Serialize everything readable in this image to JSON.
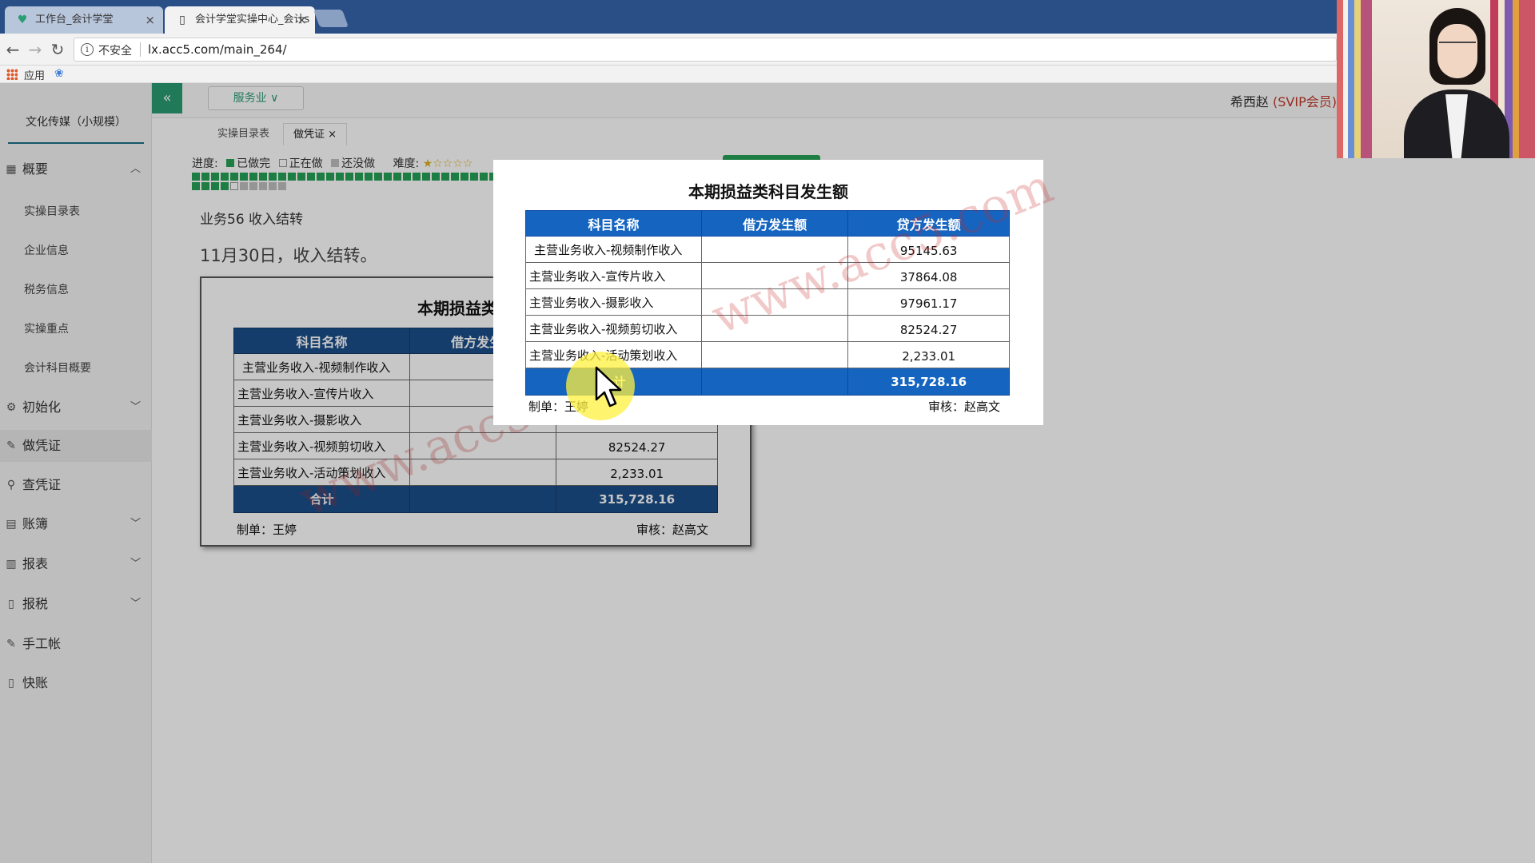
{
  "browser": {
    "tabs": [
      {
        "title": "工作台_会计学堂",
        "close": "×"
      },
      {
        "title": "会计学堂实操中心_会计s",
        "close": "×"
      }
    ],
    "security": "不安全",
    "url": "lx.acc5.com/main_264/",
    "bookmark_apps": "应用"
  },
  "header": {
    "collapse": "«",
    "industry": "服务业 ∨",
    "user": "希西赵",
    "vip": "(SVIP会员)"
  },
  "sidebar": {
    "company": "文化传媒（小规模）",
    "items": [
      {
        "label": "概要",
        "icon": "grid-icon",
        "arrow": "︿"
      },
      {
        "label": "初始化",
        "icon": "gear-icon",
        "arrow": "﹀"
      },
      {
        "label": "做凭证",
        "icon": "pen-icon",
        "arrow": ""
      },
      {
        "label": "查凭证",
        "icon": "search-icon",
        "arrow": ""
      },
      {
        "label": "账簿",
        "icon": "book-icon",
        "arrow": "﹀"
      },
      {
        "label": "报表",
        "icon": "report-icon",
        "arrow": "﹀"
      },
      {
        "label": "报税",
        "icon": "file-icon",
        "arrow": "﹀"
      },
      {
        "label": "手工帐",
        "icon": "pen-icon",
        "arrow": ""
      },
      {
        "label": "快账",
        "icon": "file-icon",
        "arrow": ""
      }
    ],
    "subitems": [
      "实操目录表",
      "企业信息",
      "税务信息",
      "实操重点",
      "会计科目概要"
    ]
  },
  "page_tabs": [
    {
      "label": "实操目录表"
    },
    {
      "label": "做凭证",
      "close": "×"
    }
  ],
  "progress": {
    "label": "进度:",
    "done": "已做完",
    "doing": "正在做",
    "todo": "还没做",
    "difficulty": "难度:",
    "difficulty_stars": "★☆☆☆☆"
  },
  "task": {
    "title": "业务56 收入结转",
    "desc": "11月30日，收入结转。"
  },
  "report": {
    "title": "本期损益类科目发生额",
    "headers": [
      "科目名称",
      "借方发生额",
      "贷方发生额"
    ],
    "rows": [
      {
        "name": "主营业务收入-视频制作收入",
        "debit": "",
        "credit": "95145.63"
      },
      {
        "name": "主营业务收入-宣传片收入",
        "debit": "",
        "credit": "37864.08"
      },
      {
        "name": "主营业务收入-摄影收入",
        "debit": "",
        "credit": "97961.17"
      },
      {
        "name": "主营业务收入-视频剪切收入",
        "debit": "",
        "credit": "82524.27"
      },
      {
        "name": "主营业务收入-活动策划收入",
        "debit": "",
        "credit": "2,233.01"
      }
    ],
    "total_label": "合计",
    "total_credit": "315,728.16",
    "maker": "制单：王婷",
    "reviewer": "审核：赵高文",
    "watermark": "www.acc5.com"
  },
  "colors": {
    "header_blue": "#1b4f8a",
    "popup_blue": "#1565c0",
    "accent_green": "#27a056",
    "vip_red": "#c0392b"
  }
}
